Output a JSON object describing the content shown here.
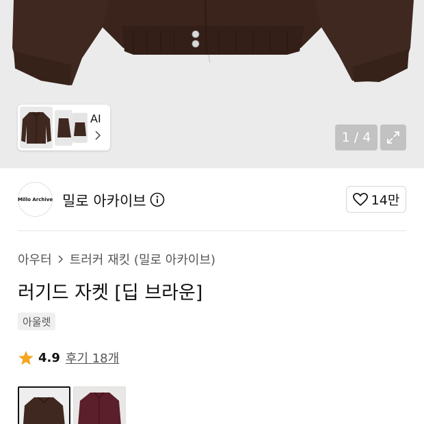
{
  "gallery": {
    "thumb_ai_label": "AI",
    "counter": "1 / 4",
    "images_total": 4,
    "current_index": 1
  },
  "brand": {
    "logo_text": "Millo Archive",
    "name": "밀로 아카이브"
  },
  "likes": {
    "count": "14만"
  },
  "breadcrumb": {
    "items": [
      "아우터",
      "트러커 재킷 (밀로 아카이브)"
    ]
  },
  "product": {
    "title": "러기드 자켓 [딥 브라운]",
    "tag": "아울렛"
  },
  "rating": {
    "score": "4.9",
    "reviews": "후기 18개"
  },
  "colors": {
    "accent_star": "#f5a623",
    "jacket_brown": "#3f2820",
    "jacket_burgundy": "#5a1f2a"
  }
}
